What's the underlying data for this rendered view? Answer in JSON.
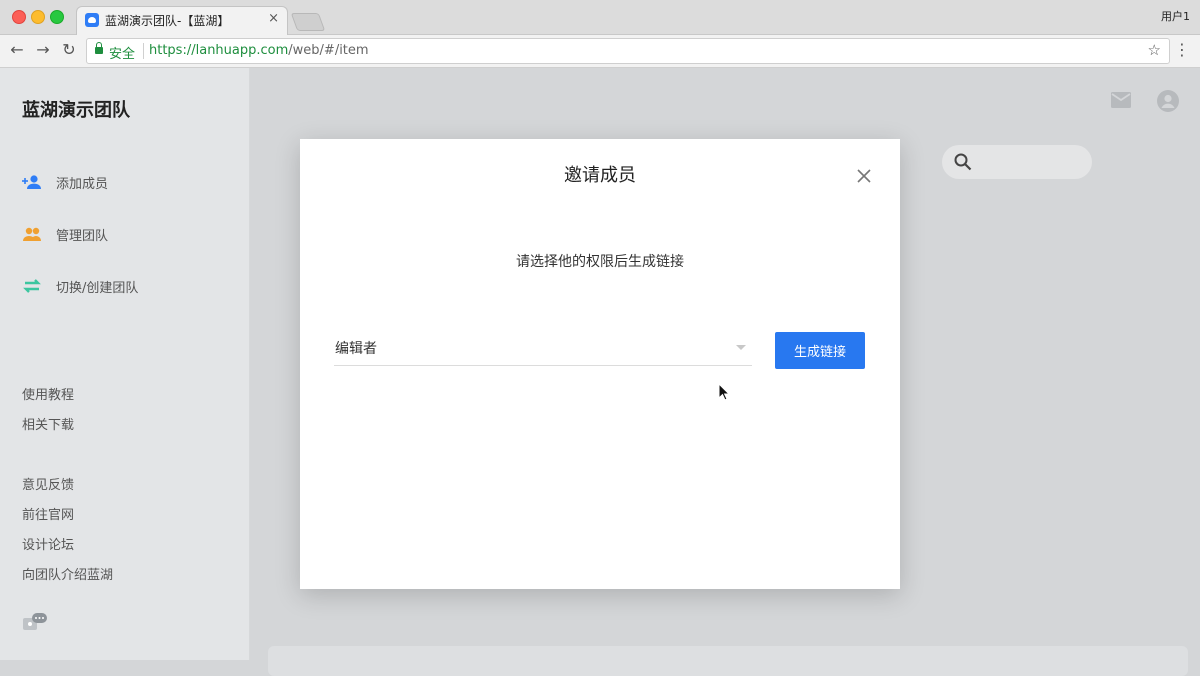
{
  "browser": {
    "tab_title": "蓝湖演示团队-【蓝湖】",
    "tab_close": "×",
    "user_label": "用户1",
    "secure_label": "安全",
    "url_scheme": "https://",
    "url_host": "lanhuapp.com",
    "url_path": "/web/#/item",
    "star": "☆",
    "menu": "⋮",
    "back": "←",
    "forward": "→",
    "reload": "↻"
  },
  "sidebar": {
    "team_name": "蓝湖演示团队",
    "items": [
      {
        "label": "添加成员",
        "icon": "add-user-icon"
      },
      {
        "label": "管理团队",
        "icon": "team-icon"
      },
      {
        "label": "切换/创建团队",
        "icon": "switch-icon"
      }
    ],
    "links_group1": [
      "使用教程",
      "相关下载"
    ],
    "links_group2": [
      "意见反馈",
      "前往官网",
      "设计论坛",
      "向团队介绍蓝湖"
    ]
  },
  "modal": {
    "title": "邀请成员",
    "description": "请选择他的权限后生成链接",
    "role_value": "编辑者",
    "generate_label": "生成链接"
  },
  "colors": {
    "accent": "#2878f0",
    "add_icon": "#2f7df6",
    "team_icon": "#f0a030",
    "switch_icon": "#3cc6a0"
  }
}
